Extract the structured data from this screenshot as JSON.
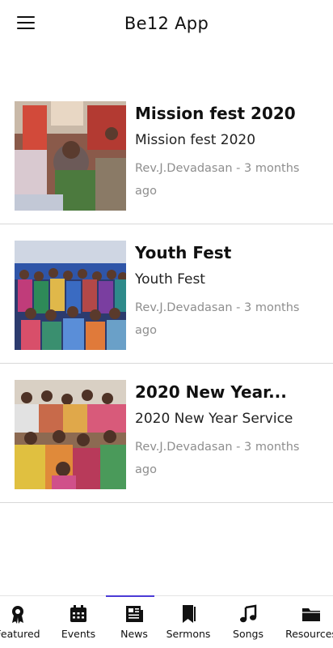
{
  "header": {
    "title": "Be12 App"
  },
  "items": [
    {
      "title": "Mission fest 2020",
      "subtitle": "Mission fest 2020",
      "author_time": "Rev.J.Devadasan - 3 months ago"
    },
    {
      "title": "Youth Fest",
      "subtitle": "Youth Fest",
      "author_time": "Rev.J.Devadasan - 3 months ago"
    },
    {
      "title": "2020 New Year...",
      "subtitle": "2020 New Year Service",
      "author_time": "Rev.J.Devadasan - 3 months ago"
    }
  ],
  "bottom_nav": {
    "active": "News",
    "items": [
      {
        "label": "Featured",
        "icon": "ribbon-icon"
      },
      {
        "label": "Events",
        "icon": "calendar-icon"
      },
      {
        "label": "News",
        "icon": "newspaper-icon"
      },
      {
        "label": "Sermons",
        "icon": "bookmark-icon"
      },
      {
        "label": "Songs",
        "icon": "music-note-icon"
      },
      {
        "label": "Resources",
        "icon": "folder-icon"
      }
    ]
  },
  "colors": {
    "accent": "#4b3bd6",
    "divider": "#d8d8d8",
    "muted_text": "#8e8e8e"
  }
}
